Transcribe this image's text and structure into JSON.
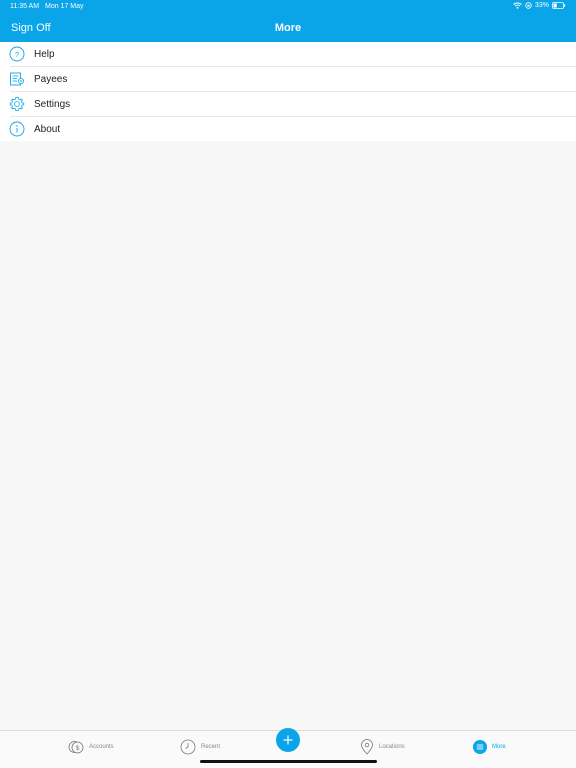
{
  "status": {
    "time": "11:35 AM",
    "date": "Mon 17 May",
    "battery": "33%"
  },
  "nav": {
    "left_button": "Sign Off",
    "title": "More"
  },
  "menu": {
    "items": [
      {
        "label": "Help",
        "icon": "help-icon"
      },
      {
        "label": "Payees",
        "icon": "payees-icon"
      },
      {
        "label": "Settings",
        "icon": "gear-icon"
      },
      {
        "label": "About",
        "icon": "info-icon"
      }
    ]
  },
  "tabs": {
    "accounts": "Accounts",
    "recent": "Recent",
    "locations": "Locations",
    "more": "More"
  },
  "colors": {
    "accent": "#0aa5e8",
    "background": "#f7f7f7"
  }
}
